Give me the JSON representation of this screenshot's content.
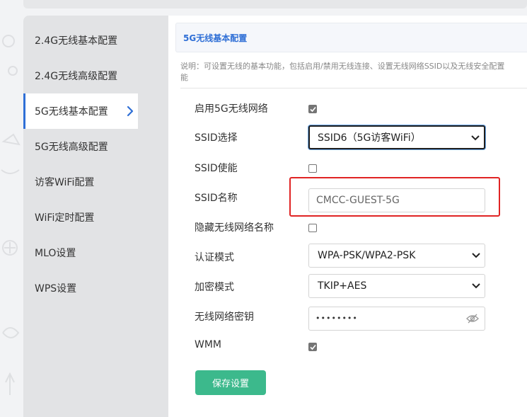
{
  "sidebar": {
    "items": [
      {
        "label": "2.4G无线基本配置",
        "active": false
      },
      {
        "label": "2.4G无线高级配置",
        "active": false
      },
      {
        "label": "5G无线基本配置",
        "active": true
      },
      {
        "label": "5G无线高级配置",
        "active": false
      },
      {
        "label": "访客WiFi配置",
        "active": false
      },
      {
        "label": "WiFi定时配置",
        "active": false
      },
      {
        "label": "MLO设置",
        "active": false
      },
      {
        "label": "WPS设置",
        "active": false
      }
    ]
  },
  "main": {
    "section_title": "5G无线基本配置",
    "note_line1": "说明：可设置无线的基本功能，包括启用/禁用无线连接、设置无线网络SSID以及无线安全配置",
    "note_line2": "能",
    "form": {
      "enable_5g_label": "启用5G无线网络",
      "enable_5g_checked": true,
      "ssid_select_label": "SSID选择",
      "ssid_select_value": "SSID6（5G访客WiFi）",
      "ssid_enable_label": "SSID使能",
      "ssid_enable_checked": false,
      "ssid_name_label": "SSID名称",
      "ssid_name_value": "CMCC-GUEST-5G",
      "hide_ssid_label": "隐藏无线网络名称",
      "hide_ssid_checked": false,
      "auth_mode_label": "认证模式",
      "auth_mode_value": "WPA-PSK/WPA2-PSK",
      "encrypt_mode_label": "加密模式",
      "encrypt_mode_value": "TKIP+AES",
      "password_label": "无线网络密钥",
      "password_mask": "••••••••",
      "wmm_label": "WMM",
      "wmm_checked": true
    },
    "save_label": "保存设置"
  },
  "colors": {
    "accent_blue": "#2f6fd6",
    "save_green": "#3cb98c",
    "highlight_red": "#e02424"
  }
}
